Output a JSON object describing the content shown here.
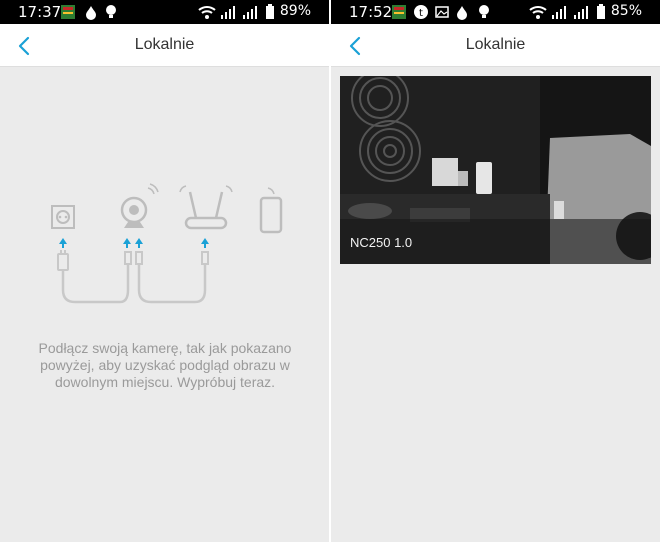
{
  "colors": {
    "accent": "#1aa1d6",
    "status_bar": "#000000",
    "background": "#ebebeb",
    "hint_text": "#9a9a9a",
    "diagram_line": "#c8c8c8"
  },
  "left": {
    "status": {
      "time": "17:37",
      "battery": "89%"
    },
    "header": {
      "title": "Lokalnie",
      "back_icon": "chevron-left-icon"
    },
    "hint": "Podłącz swoją kamerę, tak jak pokazano powyżej, aby uzyskać podgląd obrazu w dowolnym miejscu. Wypróbuj teraz."
  },
  "right": {
    "status": {
      "time": "17:52",
      "battery": "85%"
    },
    "header": {
      "title": "Lokalnie",
      "back_icon": "chevron-left-icon"
    },
    "cameras": [
      {
        "name": "NC250 1.0"
      }
    ]
  }
}
